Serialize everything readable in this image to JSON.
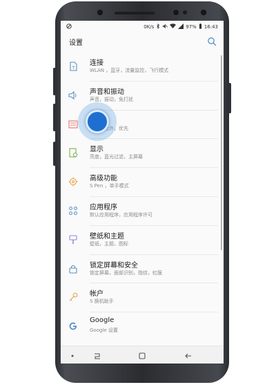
{
  "status_bar": {
    "left_icon": "sync-off-icon",
    "speed": "0K/s",
    "battery": "97%",
    "time": "16:43"
  },
  "header": {
    "title": "设置",
    "search_icon": "search-icon"
  },
  "menu": {
    "items": [
      {
        "label": "连接",
        "sub": "WLAN ，蓝牙，流量监控，飞行模式",
        "icon": "connection-icon"
      },
      {
        "label": "声音和振动",
        "sub": "声音，振动，免打扰",
        "icon": "sound-icon"
      },
      {
        "label": "通知",
        "sub": "阻止，允许，优先",
        "icon": "notification-icon"
      },
      {
        "label": "显示",
        "sub": "亮度，蓝光过滤，主屏幕",
        "icon": "display-icon"
      },
      {
        "label": "高级功能",
        "sub": "S Pen ，单手模式",
        "icon": "advanced-features-icon"
      },
      {
        "label": "应用程序",
        "sub": "默认应用程序，应用程序许可",
        "icon": "apps-icon"
      },
      {
        "label": "壁纸和主题",
        "sub": "壁纸，主题，图标",
        "icon": "wallpaper-icon"
      },
      {
        "label": "锁定屏幕和安全",
        "sub": "锁定屏幕，面部识别，指纹，虹膜",
        "icon": "lock-icon"
      },
      {
        "label": "帐户",
        "sub": "S 换机助手",
        "icon": "key-icon"
      },
      {
        "label": "Google",
        "sub": "Google 设置",
        "icon": "google-icon"
      }
    ]
  },
  "colors": {
    "accent": "#1e6fcf",
    "icon_blue": "#5a8fc7",
    "icon_orange": "#e8a24a",
    "icon_purple": "#9a7fd4",
    "icon_green": "#7fb04a"
  }
}
